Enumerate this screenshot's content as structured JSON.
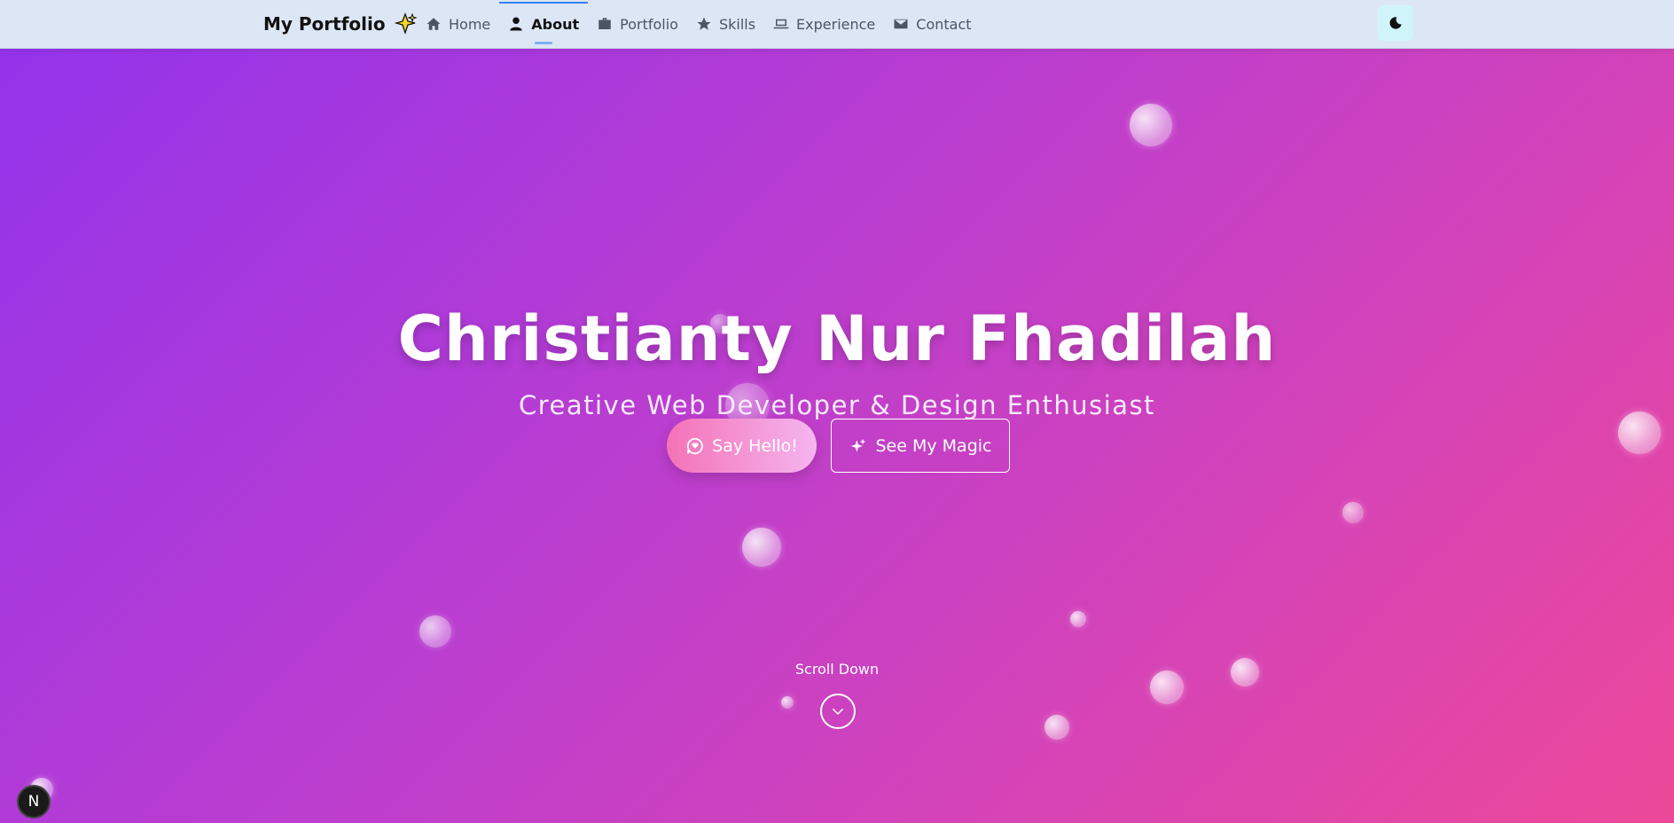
{
  "nav": {
    "brand": "My Portfolio",
    "brand_icon": "sparkle-star-icon",
    "items": [
      {
        "label": "Home",
        "icon": "home-icon",
        "active": false
      },
      {
        "label": "About",
        "icon": "user-icon",
        "active": true
      },
      {
        "label": "Portfolio",
        "icon": "briefcase-icon",
        "active": false
      },
      {
        "label": "Skills",
        "icon": "star-icon",
        "active": false
      },
      {
        "label": "Experience",
        "icon": "laptop-icon",
        "active": false
      },
      {
        "label": "Contact",
        "icon": "envelope-icon",
        "active": false
      }
    ],
    "theme_toggle_icon": "moon-icon"
  },
  "hero": {
    "title": "Christianty Nur Fhadilah",
    "subtitle": "Creative Web Developer & Design Enthusiast",
    "primary_button": "Say Hello!",
    "primary_icon": "chat-heart-icon",
    "secondary_button": "See My Magic",
    "secondary_icon": "sparkles-icon",
    "scroll_label": "Scroll Down",
    "scroll_icon": "chevron-down-icon"
  },
  "badge": {
    "letter": "N"
  },
  "colors": {
    "gradient_start": "#9333ea",
    "gradient_end": "#ec4899",
    "accent": "#3b82f6",
    "nav_bg": "#dde6f5",
    "theme_btn_bg": "#cff5fb"
  }
}
